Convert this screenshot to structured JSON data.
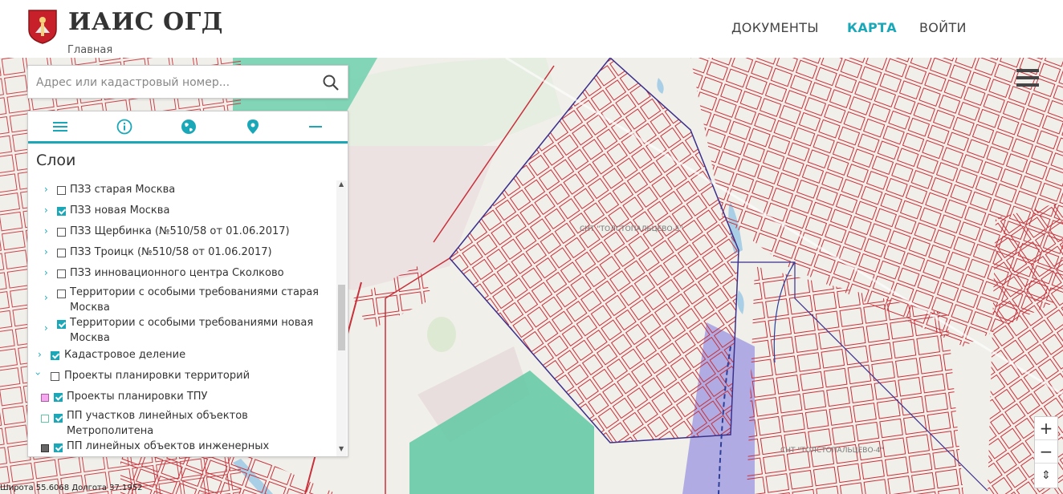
{
  "header": {
    "app_title": "ИАИС ОГД",
    "breadcrumb": "Главная",
    "nav": [
      {
        "label": "ДОКУМЕНТЫ",
        "active": false
      },
      {
        "label": "КАРТА",
        "active": true
      },
      {
        "label": "ВОЙТИ",
        "active": false
      }
    ]
  },
  "search": {
    "placeholder": "Адрес или кадастровый номер..."
  },
  "panel": {
    "tabs": [
      "menu-icon",
      "info-icon",
      "globe-icon",
      "location-pin-icon",
      "minimize-icon"
    ],
    "title": "Слои",
    "layers": [
      {
        "label": "ПЗЗ старая Москва",
        "checked": false
      },
      {
        "label": "ПЗЗ новая Москва",
        "checked": true
      },
      {
        "label": "ПЗЗ Щербинка (№510/58 от 01.06.2017)",
        "checked": false
      },
      {
        "label": "ПЗЗ Троицк (№510/58 от 01.06.2017)",
        "checked": false
      },
      {
        "label": "ПЗЗ инновационного центра Сколково",
        "checked": false
      },
      {
        "label": "Территории с особыми требованиями старая Москва",
        "checked": false
      },
      {
        "label": "Территории с особыми требованиями новая Москва",
        "checked": true
      },
      {
        "label": "Кадастровое деление",
        "checked": true
      },
      {
        "label": "Проекты планировки территорий",
        "checked": false
      },
      {
        "label": "Проекты планировки ТПУ",
        "checked": true
      },
      {
        "label": "ПП участков линейных объектов Метрополитена",
        "checked": true
      },
      {
        "label": "ПП линейных объектов инженерных",
        "checked": true
      }
    ]
  },
  "map": {
    "labels": [
      "СНТ \"ТОЛСТОПАЛЬЦЕВО-5\"",
      "СНТ \"ТОЛСТОПАЛЬЦЕВО-4\""
    ],
    "coords": "Широта 55.6068 Долгота 37.1952",
    "zoom_in": "+",
    "zoom_out": "−",
    "compass": "⇕"
  },
  "colors": {
    "accent": "#1aa8b8",
    "parcel": "#c8303a",
    "zone_green": "#5fc9a3",
    "zone_violet": "#9a95e0",
    "water": "#a9cfe6"
  }
}
